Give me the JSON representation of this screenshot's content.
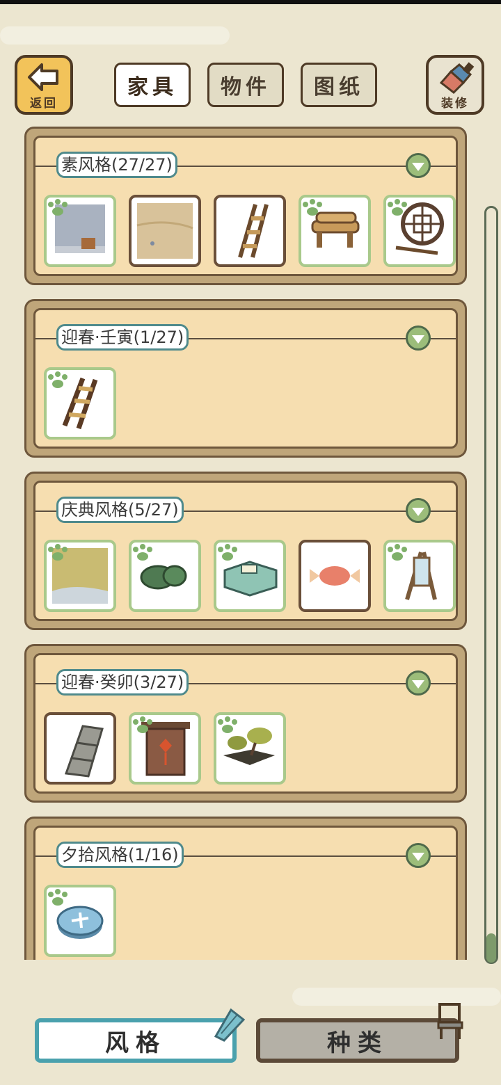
{
  "header": {
    "back_label": "返回",
    "decorate_label": "装修",
    "tabs": [
      {
        "label": "家具",
        "active": true
      },
      {
        "label": "物件",
        "active": false
      },
      {
        "label": "图纸",
        "active": false
      }
    ]
  },
  "categories": [
    {
      "title": "素风格(27/27)",
      "items": [
        "wall-item",
        "floor-item",
        "ladder-item",
        "wood-bench-item",
        "round-window-item"
      ]
    },
    {
      "title": "迎春·壬寅(1/27)",
      "items": [
        "ladder-item"
      ]
    },
    {
      "title": "庆典风格(5/27)",
      "items": [
        "wallpaper-item",
        "green-bag-item",
        "green-box-item",
        "candy-item",
        "mirror-stand-item"
      ]
    },
    {
      "title": "迎春·癸卯(3/27)",
      "items": [
        "stone-stairs-item",
        "red-door-item",
        "bonsai-item"
      ]
    },
    {
      "title": "夕拾风格(1/16)",
      "items": [
        "round-sign-item"
      ]
    }
  ],
  "footer": {
    "style_label": "风格",
    "kind_label": "种类"
  },
  "colors": {
    "panel_fill": "#f6deb0",
    "panel_border": "#6e573c",
    "title_border": "#4f8a8c",
    "active_bottom_border": "#4aa1ad",
    "green_item_border": "#a9c98b"
  }
}
